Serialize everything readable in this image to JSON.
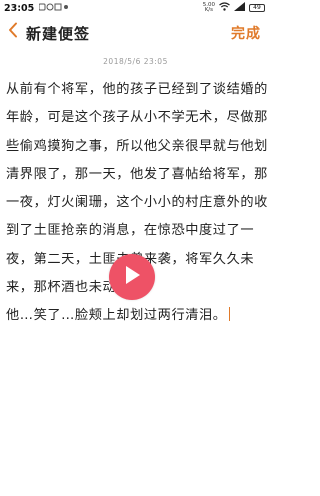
{
  "status_bar": {
    "time": "23:05",
    "net_speed_value": "5.00",
    "net_speed_unit": "K/s",
    "battery": "49"
  },
  "header": {
    "title": "新建便签",
    "done_label": "完成"
  },
  "note": {
    "timestamp": "2018/5/6 23:05",
    "paragraphs": [
      "从前有个将军，他的孩子已经到了谈结婚的年龄，可是这个孩子从小不学无术，尽做那些偷鸡摸狗之事，所以他父亲很早就与他划清界限了，那一天，他发了喜帖给将军，那一夜，灯火阑珊，这个小小的村庄意外的收到了土匪抢亲的消息，在惊恐中度过了一夜，第二天，土匪未曾来袭，将军久久未来，那杯酒也未动。",
      "他…笑了…脸颊上却划过两行清泪。"
    ]
  },
  "colors": {
    "accent": "#e07a2a",
    "play_button": "#ee5266"
  },
  "icons": [
    "back-arrow-icon",
    "wifi-icon",
    "signal-icon",
    "battery-icon",
    "play-icon"
  ]
}
